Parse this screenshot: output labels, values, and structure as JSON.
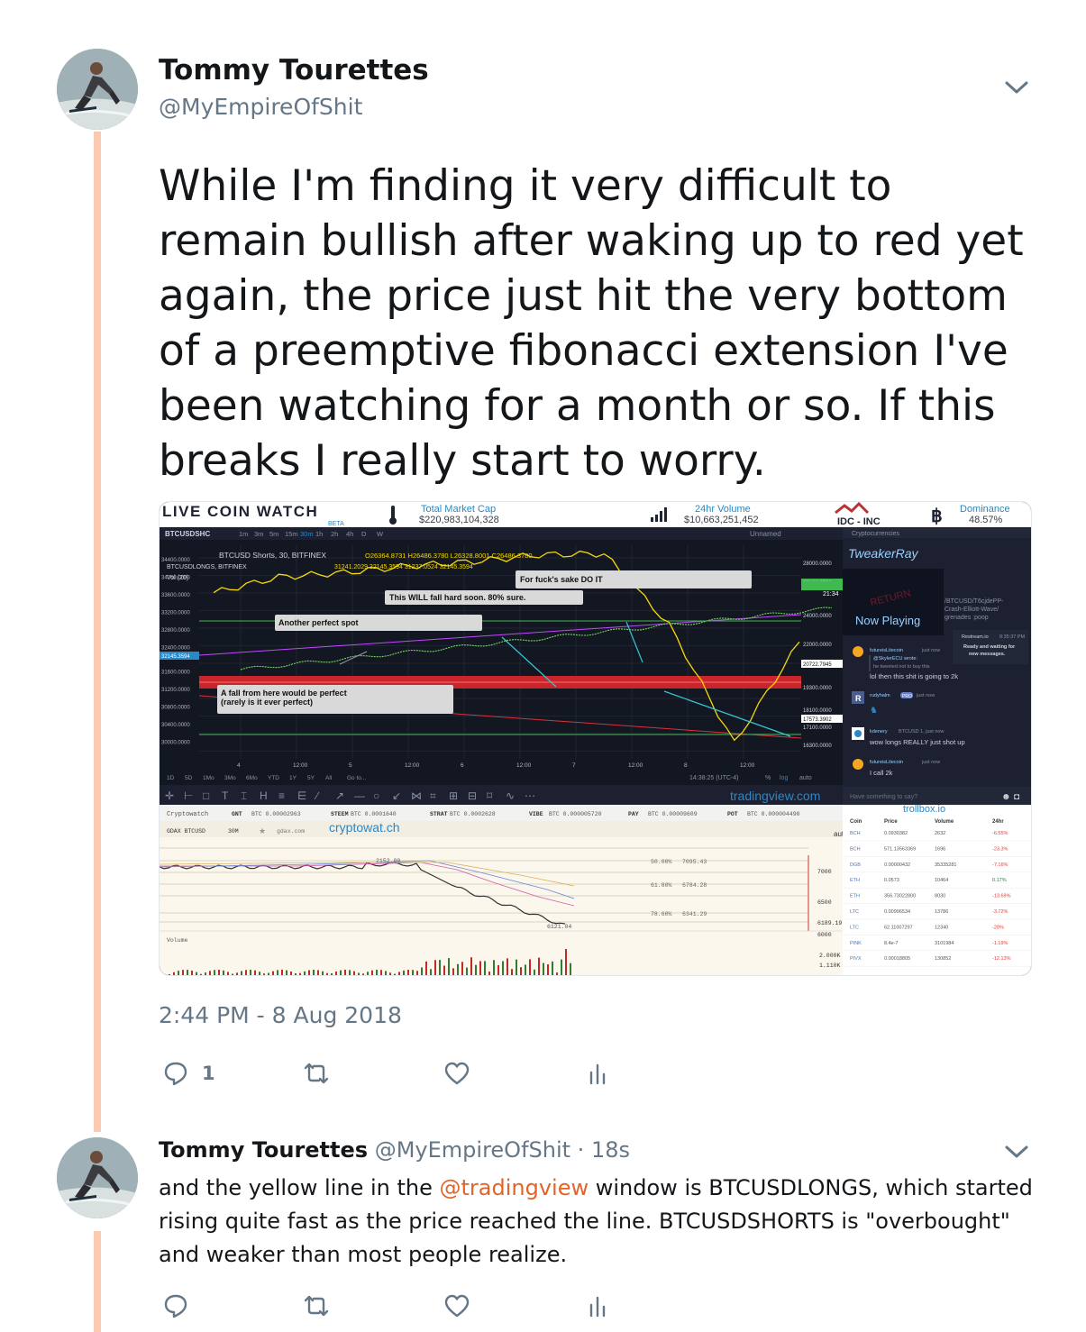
{
  "main_tweet": {
    "name": "Tommy Tourettes",
    "handle": "@MyEmpireOfShit",
    "text": "While I'm finding it very difficult to remain bullish after waking up to red yet again, the price just hit the very bottom of a preemptive fibonacci extension I've been watching for a month or so. If this breaks I really start to worry.",
    "timestamp": "2:44 PM - 8 Aug 2018",
    "reply_count": "1",
    "icons": [
      "reply-icon",
      "retweet-icon",
      "like-icon",
      "analytics-icon",
      "chevron-down-icon"
    ]
  },
  "media": {
    "header": {
      "brand": "LIVE COIN WATCH",
      "brand_tag": "BETA",
      "market_cap_label": "Total Market Cap",
      "market_cap_value": "$220,983,104,328",
      "volume_label": "24hr Volume",
      "volume_value": "$10,663,251,452",
      "idc_label": "IDC - INC",
      "dominance_label": "Dominance",
      "dominance_value": "48.57%"
    },
    "chart_toolbar": {
      "symbol": "BTCUSDSHC",
      "intervals": [
        "1m",
        "3m",
        "5m",
        "15m",
        "30m",
        "1h",
        "2h",
        "4h",
        "D",
        "W"
      ],
      "active_interval": "30m",
      "unnamed": "Unnamed"
    },
    "tv_chart": {
      "legend_line1": "BTCUSD Shorts, 30, BITFINEX",
      "legend_ohlc": "O26364.8731  H26486.3780  L26328.8001  C26486.3780",
      "legend_line2": "BTCUSDLONGS, BITFINEX",
      "legend_values2": "31241.2029  32145.3594  31237.0524  32145.3594",
      "legend_vol": "Vol (20)",
      "left_axis": [
        "34400.0000",
        "34000.0000",
        "33600.0000",
        "33200.0000",
        "32800.0000",
        "32400.0000",
        "32145.3594",
        "31600.0000",
        "31200.0000",
        "30800.0000",
        "30400.0000",
        "30000.0000"
      ],
      "right_axis": [
        "28000.0000",
        "26486.3780",
        "24000.0000",
        "22000.0000",
        "20722.7945",
        "19300.0000",
        "18100.0000",
        "17573.3902",
        "17100.0000",
        "16300.0000"
      ],
      "countdown": "21:34",
      "time_axis": [
        "4",
        "12:00",
        "5",
        "12:00",
        "6",
        "12:00",
        "7",
        "12:00",
        "8",
        "12:00"
      ],
      "ranges": [
        "1D",
        "5D",
        "1Mo",
        "3Mo",
        "6Mo",
        "YTD",
        "1Y",
        "5Y",
        "All",
        "Go to..."
      ],
      "clock": "14:38:25 (UTC-4)",
      "bottom_right": [
        "%",
        "log",
        "auto"
      ],
      "watermark": "tradingview.com",
      "annotations": [
        "For fuck's sake DO IT",
        "This WILL fall hard soon. 80% sure.",
        "Another perfect spot",
        "A fall from here would be perfect\n(rarely is it ever perfect)"
      ]
    },
    "restream": {
      "header": "Cryptocurrencies",
      "streamer": "TweakerRay",
      "stamp": "RETURN",
      "now_playing": "Now Playing",
      "side_text": "/BTCUSD/T6cjdePP-Crash-Elliott-Wave/ grenades :poop",
      "bot_name": "Restream.io",
      "bot_time": "8:35:37 PM",
      "bot_msg": "Ready and waiting for new messages.",
      "messages": [
        {
          "user": "futureisLitecoin",
          "time": "just now",
          "quote_user": "@SkylerECU wrote:",
          "quote": "he tweeted not to buy this",
          "text": "lol then this shit is going to 2k"
        },
        {
          "user": "rudyhalm",
          "badge": "PRO",
          "time": "just now",
          "text": ""
        },
        {
          "user": "kdenery",
          "time": "BTCUSD 1,  just now",
          "text": "wow longs REALLY just shot up"
        },
        {
          "user": "futureisLitecoin",
          "time": "just now",
          "text": "I call 2k"
        }
      ],
      "chat_placeholder": "Have something to say?"
    },
    "ticker": {
      "label": "Cryptowatch",
      "items": [
        {
          "sym": "GNT",
          "val": "BTC 0.00002963"
        },
        {
          "sym": "STEEM",
          "val": "BTC 0.0001640"
        },
        {
          "sym": "STRAT",
          "val": "BTC 0.0002628"
        },
        {
          "sym": "VIBE",
          "val": "BTC 0.000005720"
        },
        {
          "sym": "PAY",
          "val": "BTC 0.00009609"
        },
        {
          "sym": "POT",
          "val": "BTC 0.000004490"
        }
      ]
    },
    "cw_chart": {
      "market": "GDAX BTCUSD",
      "interval": "30M",
      "source": "gdax.com",
      "watermark": "cryptowat.ch",
      "fib_levels": [
        {
          "label": "50.00%",
          "value": "7095.43"
        },
        {
          "label": "61.80%",
          "value": "6784.28"
        },
        {
          "label": "78.60%",
          "value": "6341.29"
        }
      ],
      "peak_label": "2152.00",
      "low_label": "6121.04",
      "price_axis": [
        "7000",
        "6500",
        "6189.19",
        "6000"
      ],
      "volume_label": "Volume",
      "volume_axis": [
        "2.000K",
        "1.110K"
      ],
      "auto": "auto"
    },
    "trollbox": {
      "title": "trollbox.io",
      "columns": [
        "Coin",
        "Price",
        "Volume",
        "24hr"
      ],
      "rows": [
        {
          "coin": "BCH",
          "price": "0.0930382",
          "volume": "2632",
          "change": "-6.55%"
        },
        {
          "coin": "BCH",
          "price": "571.13563369",
          "volume": "1696",
          "change": "-23.3%"
        },
        {
          "coin": "DGB",
          "price": "0.00000432",
          "volume": "35335281",
          "change": "-7.16%"
        },
        {
          "coin": "ETH",
          "price": "0.0573",
          "volume": "10464",
          "change": "0.17%"
        },
        {
          "coin": "ETH",
          "price": "356.73022800",
          "volume": "8030",
          "change": "-13.69%"
        },
        {
          "coin": "LTC",
          "price": "0.00996534",
          "volume": "13786",
          "change": "-3.72%"
        },
        {
          "coin": "LTC",
          "price": "62.11007297",
          "volume": "12340",
          "change": "-20%"
        },
        {
          "coin": "PINK",
          "price": "8.4e-7",
          "volume": "3101984",
          "change": "-1.19%"
        },
        {
          "coin": "PIVX",
          "price": "0.00018805",
          "volume": "130852",
          "change": "-12.13%"
        }
      ]
    },
    "chart_data": {
      "type": "line",
      "title": "",
      "series": [
        {
          "name": "BTCUSD Shorts",
          "x": [
            "Aug 4 00:00",
            "Aug 4 12:00",
            "Aug 5 00:00",
            "Aug 5 12:00",
            "Aug 6 00:00",
            "Aug 6 12:00",
            "Aug 7 00:00",
            "Aug 7 12:00",
            "Aug 8 00:00",
            "Aug 8 12:00"
          ],
          "values": [
            30900,
            32300,
            32700,
            33300,
            33700,
            34300,
            34400,
            28000,
            17400,
            26486
          ]
        }
      ]
    }
  },
  "reply_tweet": {
    "name": "Tommy Tourettes",
    "handle": "@MyEmpireOfShit",
    "dot": " · ",
    "age": "18s",
    "text_before": "and the yellow line in the ",
    "mention": "@tradingview",
    "text_after": " window is BTCUSDLONGS, which started rising quite fast as the price reached the line. BTCUSDSHORTS is \"overbought\" and weaker than most people realize."
  }
}
